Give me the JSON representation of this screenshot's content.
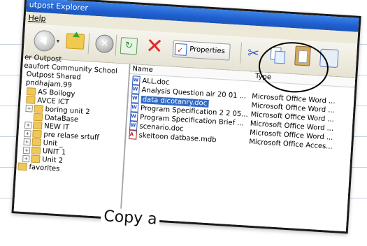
{
  "window": {
    "title": "utpost Explorer"
  },
  "menu": {
    "help": "Help"
  },
  "toolbar": {
    "properties_label": "Properties",
    "delete_glyph": "✕",
    "stop_glyph": "✕",
    "refresh_glyph": "↻",
    "cut_glyph": "✂",
    "dropdown_glyph": "▾"
  },
  "tree": {
    "items": [
      {
        "label": "er Outpost",
        "expander": ""
      },
      {
        "label": "eaufort Community School",
        "expander": ""
      },
      {
        "label": "Outpost Shared",
        "expander": ""
      },
      {
        "label": "pndhajam.99",
        "expander": ""
      },
      {
        "label": "AS Boilogy",
        "expander": ""
      },
      {
        "label": "AVCE ICT",
        "expander": ""
      },
      {
        "label": "boring unit 2",
        "expander": "+"
      },
      {
        "label": "DataBase",
        "expander": ""
      },
      {
        "label": "NEW IT",
        "expander": "+"
      },
      {
        "label": "pre relase srtuff",
        "expander": "+"
      },
      {
        "label": "Unit _",
        "expander": "+"
      },
      {
        "label": "UNIT 1",
        "expander": "+"
      },
      {
        "label": "Unit 2",
        "expander": "+"
      },
      {
        "label": "favorites",
        "expander": ""
      }
    ]
  },
  "files": {
    "columns": {
      "name": "Name",
      "type": "Type"
    },
    "rows": [
      {
        "name": "ALL.doc",
        "type": ""
      },
      {
        "name": "Analysis Question air  20 01 ...",
        "type": "Microsoft Office Word ..."
      },
      {
        "name": "data dicotanry.doc",
        "type": "Microsoft Office Word ..."
      },
      {
        "name": "Program Specification 2 2 05...",
        "type": "Microsoft Office Word ..."
      },
      {
        "name": "Program Specification Brief ...",
        "type": "Microsoft Office Word ..."
      },
      {
        "name": "scenario.doc",
        "type": "Microsoft Office Word ..."
      },
      {
        "name": "skeltoon datbase.mdb",
        "type": "Microsoft Office Acces..."
      }
    ]
  },
  "caption": "Copy a"
}
